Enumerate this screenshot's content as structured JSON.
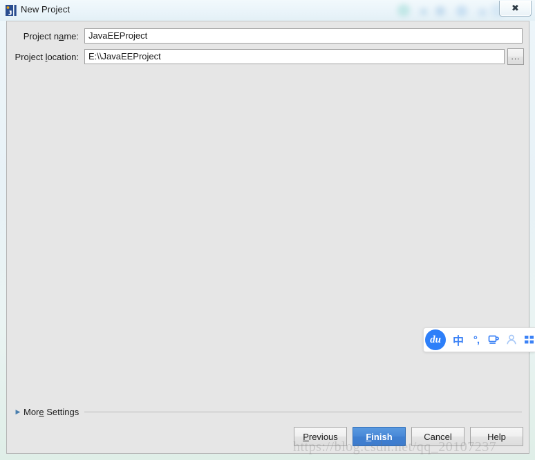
{
  "window": {
    "title": "New Project",
    "app_icon": "intellij-idea-icon",
    "close_label": "✖"
  },
  "form": {
    "project_name": {
      "label_before": "Project n",
      "label_mnemonic": "a",
      "label_after": "me:",
      "value": "JavaEEProject",
      "placeholder": ""
    },
    "project_location": {
      "label_before": "Project ",
      "label_mnemonic": "l",
      "label_after": "ocation:",
      "value": "E:\\\\JavaEEProject",
      "placeholder": "",
      "browse_label": "..."
    }
  },
  "more_settings": {
    "arrow": "▶",
    "label_before": "Mor",
    "label_mnemonic": "e",
    "label_after": " Settings"
  },
  "buttons": {
    "previous": {
      "before": "",
      "mnemonic": "P",
      "after": "revious"
    },
    "finish": {
      "before": "",
      "mnemonic": "F",
      "after": "inish"
    },
    "cancel": {
      "before": "",
      "mnemonic": "",
      "after": "Cancel"
    },
    "help": {
      "before": "",
      "mnemonic": "",
      "after": "Help"
    }
  },
  "ime_toolbar": {
    "logo": "du",
    "language_mode": "中",
    "punctuation_mode": "°,",
    "cup_icon": "keyboard-cup-icon",
    "user_icon": "user-icon",
    "grid_icon": "apps-grid-icon"
  },
  "watermark": {
    "text": "https://blog.csdn.net/qq_20107237"
  },
  "colors": {
    "accent": "#3d7cce",
    "panel": "#e6e6e6",
    "ime_blue": "#2d7ff9",
    "glass_top": "#f2f9fc"
  }
}
